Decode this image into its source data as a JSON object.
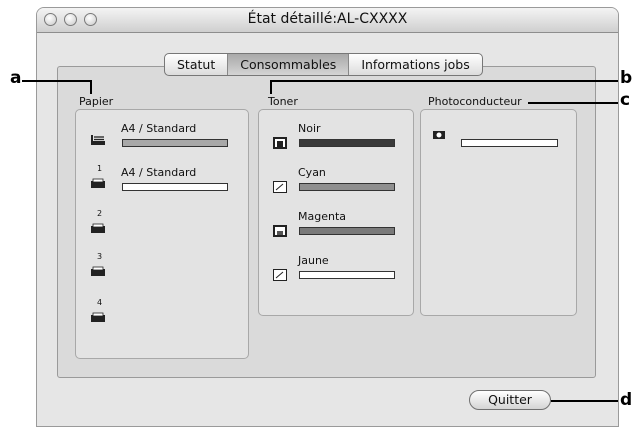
{
  "window": {
    "title": "État détaillé:AL-CXXXX"
  },
  "tabs": [
    {
      "label": "Statut",
      "active": false
    },
    {
      "label": "Consommables",
      "active": true
    },
    {
      "label": "Informations jobs",
      "active": false
    }
  ],
  "paper": {
    "label": "Papier",
    "trays": [
      {
        "icon": "mp-tray-icon",
        "label": "A4 / Standard",
        "level": 1.0,
        "bar_color": "#a8a8a8"
      },
      {
        "icon": "tray-1-icon",
        "tray_number": "1",
        "label": "A4 / Standard",
        "level": 1.0,
        "bar_color": "#ffffff"
      },
      {
        "icon": "tray-2-icon",
        "tray_number": "2",
        "label": ""
      },
      {
        "icon": "tray-3-icon",
        "tray_number": "3",
        "label": ""
      },
      {
        "icon": "tray-4-icon",
        "tray_number": "4",
        "label": ""
      }
    ]
  },
  "toner": {
    "label": "Toner",
    "items": [
      {
        "icon": "toner-black-icon",
        "label": "Noir",
        "level": 1.0,
        "color": "#3a3a3a"
      },
      {
        "icon": "toner-cyan-icon",
        "label": "Cyan",
        "level": 1.0,
        "color": "#8f8f8f"
      },
      {
        "icon": "toner-magenta-icon",
        "label": "Magenta",
        "level": 1.0,
        "color": "#7a7a7a"
      },
      {
        "icon": "toner-yellow-icon",
        "label": "Jaune",
        "level": 1.0,
        "color": "#ffffff"
      }
    ]
  },
  "photoconductor": {
    "label": "Photoconducteur",
    "level": 1.0,
    "bar_color": "#ffffff",
    "icon": "photoconductor-icon"
  },
  "quit_button": {
    "label": "Quitter"
  },
  "callouts": {
    "a": "a",
    "b": "b",
    "c": "c",
    "d": "d"
  }
}
